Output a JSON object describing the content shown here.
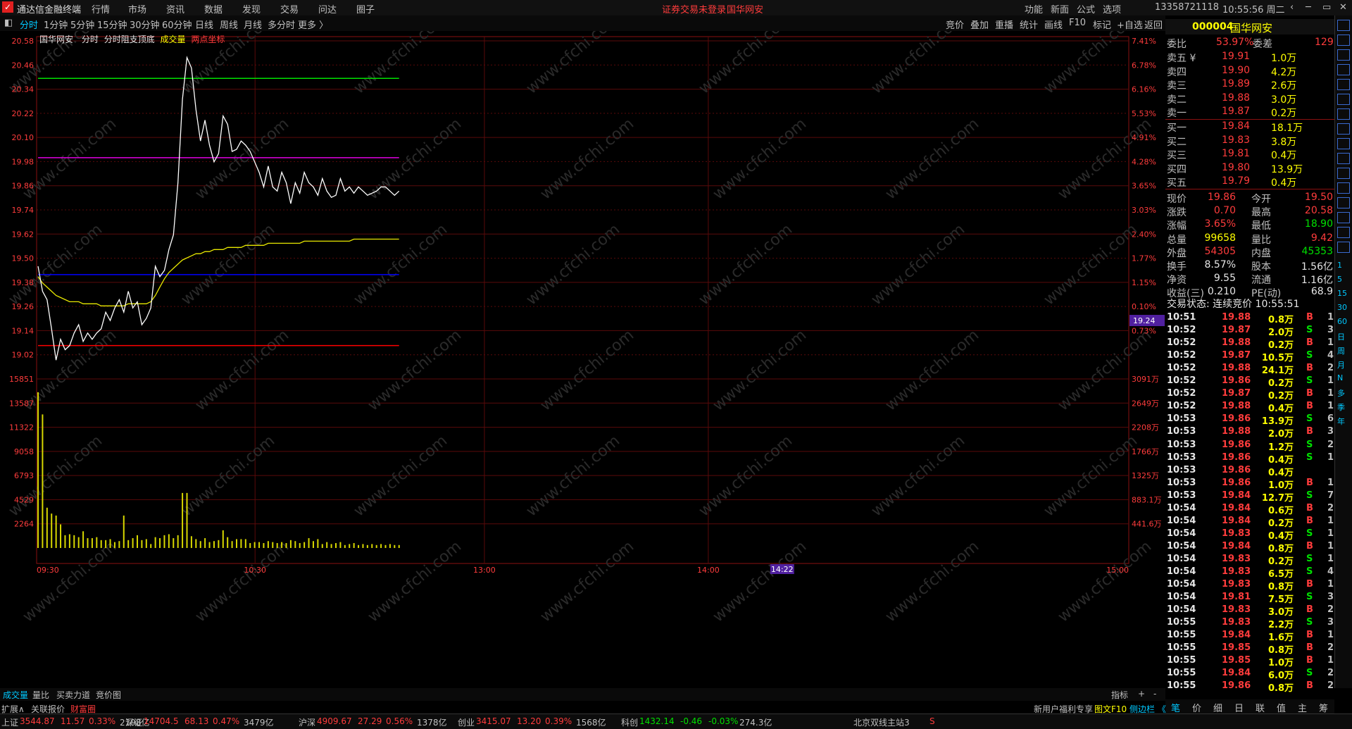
{
  "app": {
    "title": "通达信金融终端",
    "menus": [
      "行情",
      "市场",
      "资讯",
      "数据",
      "发现",
      "交易",
      "问达",
      "圈子"
    ],
    "login": "证券交易未登录",
    "stock_name": "国华网安",
    "right_menus": [
      "功能",
      "新面",
      "公式",
      "选项"
    ],
    "account": "13358721118",
    "clock": "10:55:56 周二"
  },
  "toolbar": {
    "periods": [
      "分时",
      "1分钟",
      "5分钟",
      "15分钟",
      "30分钟",
      "60分钟",
      "日线",
      "周线",
      "月线",
      "多分时",
      "更多 〉"
    ],
    "tools": [
      "竞价",
      "叠加",
      "重播",
      "统计",
      "画线",
      "F10",
      "标记",
      "+自选",
      "返回"
    ]
  },
  "chart_header": {
    "name": "国华网安",
    "tabs": [
      "分时",
      "分时阻支顶底",
      "成交量",
      "两点坐标"
    ]
  },
  "chart_data": {
    "type": "line",
    "price_axis": [
      "20.58",
      "20.46",
      "20.34",
      "20.22",
      "20.10",
      "19.98",
      "19.86",
      "19.74",
      "19.62",
      "19.50",
      "19.38",
      "19.26",
      "19.14",
      "19.02"
    ],
    "pct_axis": [
      "7.41%",
      "6.78%",
      "6.16%",
      "5.53%",
      "4.91%",
      "4.28%",
      "3.65%",
      "3.03%",
      "2.40%",
      "1.77%",
      "1.15%",
      "0.10%",
      "0.73%"
    ],
    "vol_axis": [
      "15851",
      "13587",
      "11322",
      "9058",
      "6793",
      "4529",
      "2264"
    ],
    "vol_axis_right": [
      "3091万",
      "2649万",
      "2208万",
      "1766万",
      "1325万",
      "883.1万",
      "441.6万"
    ],
    "time_axis": [
      "09:30",
      "10:30",
      "13:00",
      "14:00",
      "15:00"
    ],
    "cursor_time": "14:22",
    "cursor_price": "19.24",
    "ylim": [
      18.96,
      20.6
    ],
    "price": [
      19.5,
      19.38,
      19.34,
      19.2,
      19.05,
      19.15,
      19.1,
      19.12,
      19.18,
      19.22,
      19.14,
      19.18,
      19.15,
      19.18,
      19.2,
      19.28,
      19.24,
      19.3,
      19.34,
      19.28,
      19.38,
      19.3,
      19.33,
      19.22,
      19.25,
      19.3,
      19.5,
      19.45,
      19.48,
      19.58,
      19.65,
      19.9,
      20.3,
      20.5,
      20.45,
      20.25,
      20.1,
      20.2,
      20.08,
      20.0,
      20.04,
      20.22,
      20.18,
      20.05,
      20.06,
      20.1,
      20.08,
      20.05,
      20.0,
      19.95,
      19.88,
      19.98,
      19.88,
      19.86,
      19.95,
      19.9,
      19.8,
      19.9,
      19.85,
      19.95,
      19.9,
      19.88,
      19.84,
      19.92,
      19.86,
      19.83,
      19.84,
      19.92,
      19.86,
      19.88,
      19.85,
      19.88,
      19.86,
      19.84,
      19.85,
      19.86,
      19.88,
      19.88,
      19.86,
      19.84,
      19.86
    ],
    "avg": [
      19.45,
      19.42,
      19.4,
      19.38,
      19.36,
      19.35,
      19.34,
      19.33,
      19.33,
      19.33,
      19.32,
      19.32,
      19.32,
      19.32,
      19.31,
      19.31,
      19.31,
      19.31,
      19.31,
      19.31,
      19.32,
      19.32,
      19.32,
      19.32,
      19.32,
      19.33,
      19.36,
      19.4,
      19.44,
      19.47,
      19.49,
      19.51,
      19.53,
      19.54,
      19.55,
      19.56,
      19.56,
      19.57,
      19.57,
      19.58,
      19.58,
      19.58,
      19.59,
      19.59,
      19.59,
      19.59,
      19.6,
      19.6,
      19.6,
      19.6,
      19.6,
      19.61,
      19.61,
      19.61,
      19.61,
      19.61,
      19.61,
      19.61,
      19.61,
      19.62,
      19.62,
      19.62,
      19.62,
      19.62,
      19.62,
      19.62,
      19.62,
      19.62,
      19.62,
      19.62,
      19.63,
      19.63,
      19.63,
      19.63,
      19.63,
      19.63,
      19.63,
      19.63,
      19.63,
      19.63,
      19.63
    ],
    "volume": [
      15851,
      13587,
      4100,
      3500,
      3300,
      2400,
      1300,
      1400,
      1300,
      1100,
      1700,
      1000,
      1000,
      1100,
      800,
      800,
      900,
      600,
      700,
      3300,
      800,
      1000,
      1300,
      800,
      900,
      400,
      1100,
      1000,
      1300,
      1400,
      1000,
      1300,
      5600,
      5600,
      1200,
      900,
      700,
      1000,
      600,
      700,
      800,
      1800,
      1100,
      700,
      900,
      900,
      900,
      500,
      600,
      600,
      500,
      700,
      600,
      500,
      600,
      500,
      800,
      700,
      500,
      600,
      1000,
      700,
      900,
      400,
      600,
      400,
      500,
      600,
      300,
      400,
      500,
      300,
      400,
      300,
      400,
      300,
      400,
      300,
      400,
      300,
      300
    ],
    "vmax": 17200,
    "ref_lines": [
      {
        "price": 20.4,
        "color": "#00e000"
      },
      {
        "price": 20.02,
        "color": "#e000e0"
      },
      {
        "price": 19.46,
        "color": "#0000ff"
      },
      {
        "price": 19.12,
        "color": "#ff0000"
      }
    ]
  },
  "panel": {
    "code": "000004",
    "name": "国华网安",
    "webi_label": "委比",
    "webi": "53.97%",
    "weicha_label": "委差",
    "weicha": "129",
    "sell": [
      [
        "卖五 ¥",
        "19.91",
        "1.0万"
      ],
      [
        "卖四",
        "19.90",
        "4.2万"
      ],
      [
        "卖三",
        "19.89",
        "2.6万"
      ],
      [
        "卖二",
        "19.88",
        "3.0万"
      ],
      [
        "卖一",
        "19.87",
        "0.2万"
      ]
    ],
    "buy": [
      [
        "买一",
        "19.84",
        "18.1万"
      ],
      [
        "买二",
        "19.83",
        "3.8万"
      ],
      [
        "买三",
        "19.81",
        "0.4万"
      ],
      [
        "买四",
        "19.80",
        "13.9万"
      ],
      [
        "买五",
        "19.79",
        "0.4万"
      ]
    ],
    "stats": [
      [
        "现价",
        "19.86",
        "今开",
        "19.50"
      ],
      [
        "涨跌",
        "0.70",
        "最高",
        "20.58"
      ],
      [
        "涨幅",
        "3.65%",
        "最低",
        "18.90"
      ],
      [
        "总量",
        "99658",
        "量比",
        "9.42"
      ],
      [
        "外盘",
        "54305",
        "内盘",
        "45353"
      ],
      [
        "换手",
        "8.57%",
        "股本",
        "1.56亿"
      ],
      [
        "净资",
        "9.55",
        "流通",
        "1.16亿"
      ],
      [
        "收益(三)",
        "0.210",
        "PE(动)",
        "68.9"
      ]
    ],
    "trade_status": "交易状态: 连续竞价 10:55:51",
    "ticks": [
      [
        "10:51",
        "19.88",
        "0.8万",
        "B",
        "1"
      ],
      [
        "10:52",
        "19.87",
        "2.0万",
        "S",
        "3"
      ],
      [
        "10:52",
        "19.88",
        "0.2万",
        "B",
        "1"
      ],
      [
        "10:52",
        "19.87",
        "10.5万",
        "S",
        "4"
      ],
      [
        "10:52",
        "19.88",
        "24.1万",
        "B",
        "2"
      ],
      [
        "10:52",
        "19.86",
        "0.2万",
        "S",
        "1"
      ],
      [
        "10:52",
        "19.87",
        "0.2万",
        "B",
        "1"
      ],
      [
        "10:52",
        "19.88",
        "0.4万",
        "B",
        "1"
      ],
      [
        "10:53",
        "19.86",
        "13.9万",
        "S",
        "6"
      ],
      [
        "10:53",
        "19.88",
        "2.0万",
        "B",
        "3"
      ],
      [
        "10:53",
        "19.86",
        "1.2万",
        "S",
        "2"
      ],
      [
        "10:53",
        "19.86",
        "0.4万",
        "S",
        "1"
      ],
      [
        "10:53",
        "19.86",
        "0.4万",
        "",
        ""
      ],
      [
        "10:53",
        "19.86",
        "1.0万",
        "B",
        "1"
      ],
      [
        "10:53",
        "19.84",
        "12.7万",
        "S",
        "7"
      ],
      [
        "10:54",
        "19.84",
        "0.6万",
        "B",
        "2"
      ],
      [
        "10:54",
        "19.84",
        "0.2万",
        "B",
        "1"
      ],
      [
        "10:54",
        "19.83",
        "0.4万",
        "S",
        "1"
      ],
      [
        "10:54",
        "19.84",
        "0.8万",
        "B",
        "1"
      ],
      [
        "10:54",
        "19.83",
        "0.2万",
        "S",
        "1"
      ],
      [
        "10:54",
        "19.83",
        "6.5万",
        "S",
        "4"
      ],
      [
        "10:54",
        "19.83",
        "0.8万",
        "B",
        "1"
      ],
      [
        "10:54",
        "19.81",
        "7.5万",
        "S",
        "3"
      ],
      [
        "10:54",
        "19.83",
        "3.0万",
        "B",
        "2"
      ],
      [
        "10:55",
        "19.83",
        "2.2万",
        "S",
        "3"
      ],
      [
        "10:55",
        "19.84",
        "1.6万",
        "B",
        "1"
      ],
      [
        "10:55",
        "19.85",
        "0.8万",
        "B",
        "2"
      ],
      [
        "10:55",
        "19.85",
        "1.0万",
        "B",
        "1"
      ],
      [
        "10:55",
        "19.84",
        "6.0万",
        "S",
        "2"
      ],
      [
        "10:55",
        "19.86",
        "0.8万",
        "B",
        "2"
      ]
    ]
  },
  "bottom_tabs": [
    "成交量",
    "量比",
    "买卖力道",
    "竞价图"
  ],
  "bottom_right": [
    "指标",
    "+",
    "-"
  ],
  "panel_tabs": [
    "笔",
    "价",
    "细",
    "日",
    "联",
    "值",
    "主",
    "筹"
  ],
  "status": {
    "expand": "扩展∧",
    "related": "关联报价",
    "caifu": "财富圈",
    "indices": [
      [
        "上证",
        "3544.87",
        "11.57",
        "0.33%",
        "2198亿"
      ],
      [
        "深证",
        "14704.5",
        "68.13",
        "0.47%",
        "3479亿"
      ],
      [
        "沪深",
        "4909.67",
        "27.29",
        "0.56%",
        "1378亿"
      ],
      [
        "创业",
        "3415.07",
        "13.20",
        "0.39%",
        "1568亿"
      ],
      [
        "科创",
        "1432.14",
        "-0.46",
        "-0.03%",
        "274.3亿"
      ]
    ],
    "server": "北京双线主站3",
    "news": "新用户福利专享",
    "f10": "图文F10",
    "sidebar": "侧边栏 《"
  },
  "rightbar_items": [
    "1",
    "5",
    "15",
    "30",
    "60",
    "日",
    "周",
    "月",
    "N",
    "多",
    "季",
    "年"
  ],
  "watermark": "www.cfchi.com"
}
